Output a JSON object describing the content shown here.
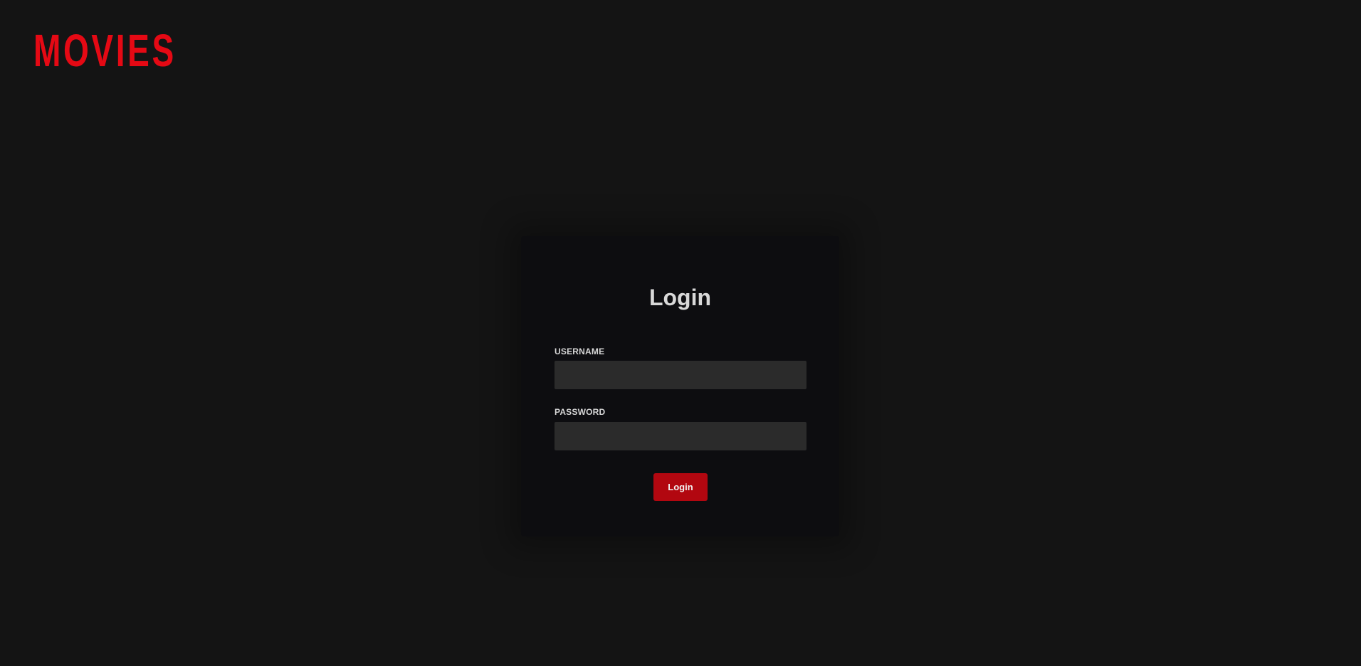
{
  "header": {
    "logo_text": "MOVIES"
  },
  "login_card": {
    "title": "Login",
    "username": {
      "label": "USERNAME",
      "value": "",
      "placeholder": ""
    },
    "password": {
      "label": "PASSWORD",
      "value": "",
      "placeholder": ""
    },
    "submit_label": "Login"
  },
  "colors": {
    "background": "#141414",
    "card": "#0d0d10",
    "brand_red": "#e50914",
    "button_red": "#b20710",
    "input_bg": "#2b2b2b"
  }
}
